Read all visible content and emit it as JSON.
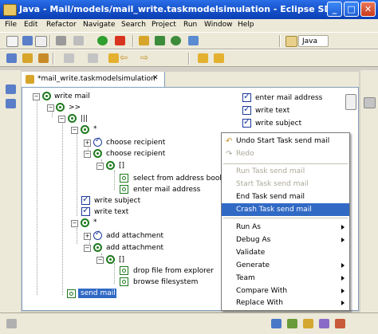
{
  "window": {
    "title": "Java - Mail/models/mail_write.taskmodelsimulation - Eclipse SDK"
  },
  "menu": [
    "File",
    "Edit",
    "Refactor",
    "Navigate",
    "Search",
    "Project",
    "Run",
    "Window",
    "Help"
  ],
  "perspective": {
    "label": "Java"
  },
  "editor_tab": {
    "label": "*mail_write.taskmodelsimulation",
    "close": "✕"
  },
  "tree": {
    "root": "write mail",
    "op_seq": ">>",
    "op_par": "|||",
    "star1": "*",
    "choose1": "choose recipient",
    "choose2": "choose recipient",
    "opt1": "[]",
    "select_book": "select from address book",
    "enter_addr": "enter mail address",
    "write_subject": "write subject",
    "write_text": "write text",
    "star2": "*",
    "add_att1": "add attachment",
    "add_att2": "add attachment",
    "opt2": "[]",
    "drop_file": "drop file from explorer",
    "browse_fs": "browse filesystem",
    "send_mail": "send mail"
  },
  "right_list": [
    "enter mail address",
    "write text",
    "write subject"
  ],
  "context_menu": {
    "undo": "Undo Start Task send mail",
    "redo": "Redo",
    "run_task": "Run Task send mail",
    "start_task": "Start Task send mail",
    "end_task": "End Task send mail",
    "crash_task": "Crash Task send mail",
    "run_as": "Run As",
    "debug_as": "Debug As",
    "validate": "Validate",
    "generate": "Generate",
    "team": "Team",
    "compare_with": "Compare With",
    "replace_with": "Replace With"
  },
  "colors": {
    "titlebar": "#0b3fb4",
    "selection": "#316ac5",
    "task_green": "#1f7a1f",
    "check_blue": "#1c3a9c"
  }
}
